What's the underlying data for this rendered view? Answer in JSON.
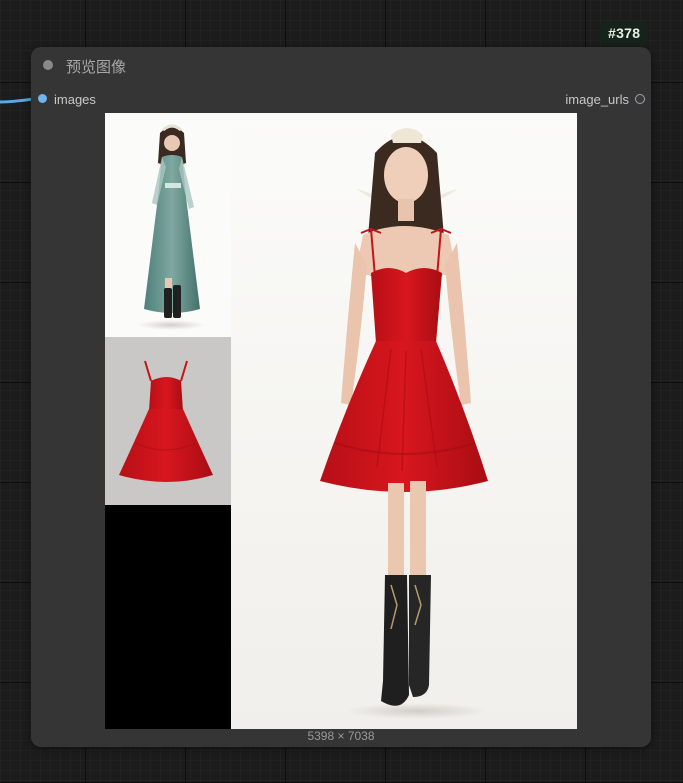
{
  "node": {
    "id_badge": "#378",
    "title": "预览图像",
    "input_slot": "images",
    "output_slot": "image_urls",
    "image_dimensions": "5398 × 7038"
  },
  "colors": {
    "canvas_bg": "#1c1c1c",
    "node_bg": "#353535",
    "input_slot": "#6fb4ee",
    "wire": "#5aa9e6",
    "badge_bg": "#15231a"
  },
  "image": {
    "composition": "three stacked reference thumbnails on left, large full-body photo on right",
    "tiles": [
      "teal-dress-reference",
      "red-dress-product",
      "empty-black"
    ]
  }
}
